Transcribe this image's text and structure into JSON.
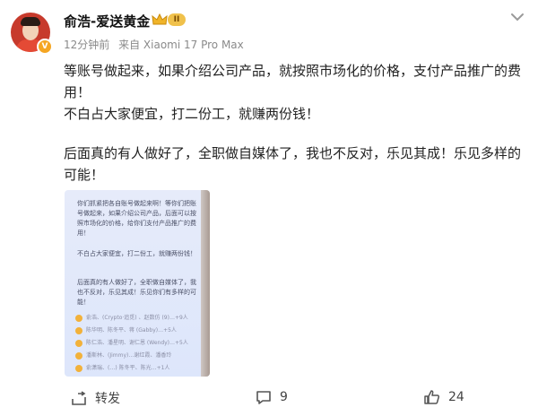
{
  "post": {
    "author": "俞浩-爱送黄金",
    "level": "II",
    "time": "12分钟前",
    "source": "来自 Xiaomi 17 Pro Max",
    "paragraphs": [
      "等账号做起来，如果介绍公司产品，就按照市场化的价格，支付产品推广的费用！",
      "不白占大家便宜，打二份工，就赚两份钱！",
      "后面真的有人做好了，全职做自媒体了，我也不反对，乐见其成！乐见多样的可能！"
    ]
  },
  "embedded_screenshot": {
    "paragraphs": [
      "你们抓紧把各自账号做起来啊！等你们把账号做起来，如果介绍公司产品，后面可以按照市场化的价格，给你们支付产品推广的费用！",
      "不白占大家便宜，打二份工，就赚两份钱！",
      "后面真的有人做好了，全职做自媒体了，我也不反对，乐见其成！乐见你们有多样的可能！"
    ],
    "reactions": [
      "俞浩、(Crypto·追觅) 、赵数仿 (9)…+9人",
      "陈华明、陈冬平、蒋 (Gabby)…+5人",
      "陈仁浩、潘星明、谢仁恩 (Wendy)…+5人",
      "潘斯林、(Jimmy)…谢红霞、潘香玲",
      "俞潇瑞、(…) 陈冬平、陈光…+1人"
    ]
  },
  "actions": {
    "repost_label": "转发",
    "comments_count": "9",
    "likes_count": "24"
  },
  "colors": {
    "meta_gray": "#8a8a8a",
    "avatar_red": "#c73a2c",
    "badge_gold": "#f0c14b"
  },
  "icons": {
    "more": "chevron-down-icon",
    "repost": "repost-icon",
    "comment": "comment-icon",
    "like": "like-icon"
  }
}
